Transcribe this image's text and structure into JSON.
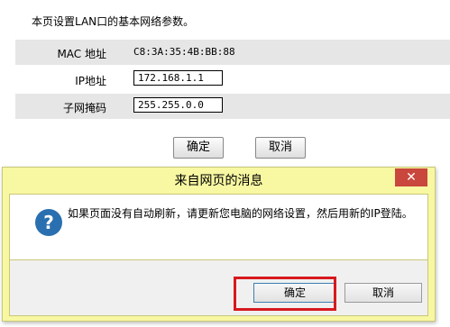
{
  "page": {
    "intro": "本页设置LAN口的基本网络参数。",
    "rows": [
      {
        "label": "MAC 地址",
        "value": "C8:3A:35:4B:BB:88"
      },
      {
        "label": "IP地址",
        "value": "172.168.1.1"
      },
      {
        "label": "子网掩码",
        "value": "255.255.0.0"
      }
    ],
    "ok_label": "确定",
    "cancel_label": "取消"
  },
  "dialog": {
    "title": "来自网页的消息",
    "close_glyph": "✕",
    "message": "如果页面没有自动刷新，请更新您电脑的网络设置，然后用新的IP登陆。",
    "ok_label": "确定",
    "cancel_label": "取消"
  },
  "colors": {
    "dialog_frame": "#f8f7a2",
    "close_button": "#c9473c",
    "highlight": "#d7191e",
    "question_icon": "#2a6fb0"
  }
}
